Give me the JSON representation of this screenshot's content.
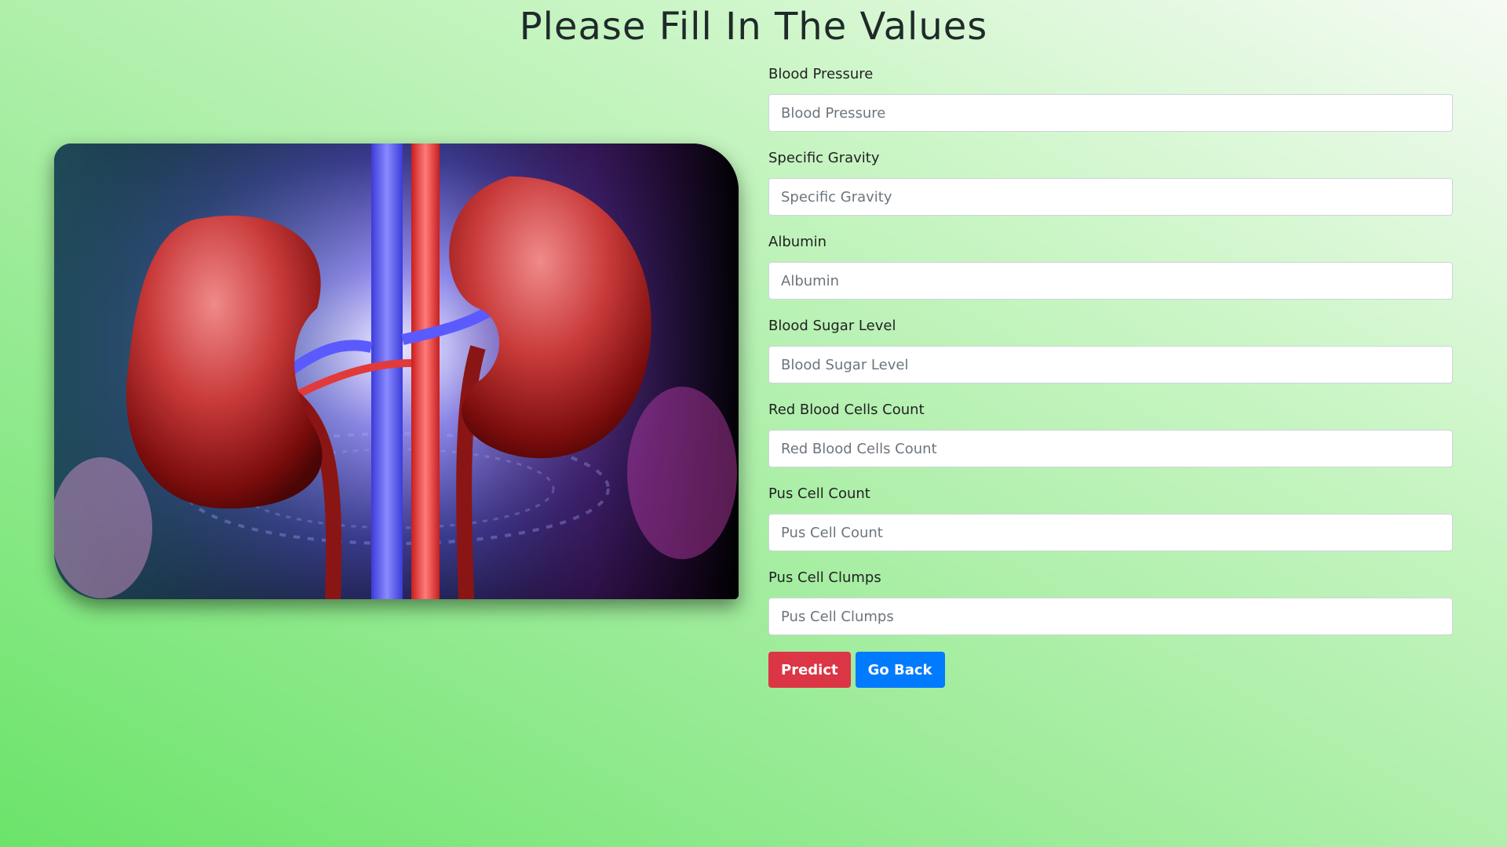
{
  "page": {
    "title": "Please Fill In The Values"
  },
  "hero_image": {
    "icon": "kidney-illustration"
  },
  "form": {
    "fields": [
      {
        "label": "Blood Pressure",
        "placeholder": "Blood Pressure",
        "value": ""
      },
      {
        "label": "Specific Gravity",
        "placeholder": "Specific Gravity",
        "value": ""
      },
      {
        "label": "Albumin",
        "placeholder": "Albumin",
        "value": ""
      },
      {
        "label": "Blood Sugar Level",
        "placeholder": "Blood Sugar Level",
        "value": ""
      },
      {
        "label": "Red Blood Cells Count",
        "placeholder": "Red Blood Cells Count",
        "value": ""
      },
      {
        "label": "Pus Cell Count",
        "placeholder": "Pus Cell Count",
        "value": ""
      },
      {
        "label": "Pus Cell Clumps",
        "placeholder": "Pus Cell Clumps",
        "value": ""
      }
    ],
    "predict_label": "Predict",
    "go_back_label": "Go Back"
  },
  "colors": {
    "predict_button": "#dc3545",
    "go_back_button": "#007bff",
    "background_start": "#6be36a",
    "background_end": "#f6fbf4"
  }
}
